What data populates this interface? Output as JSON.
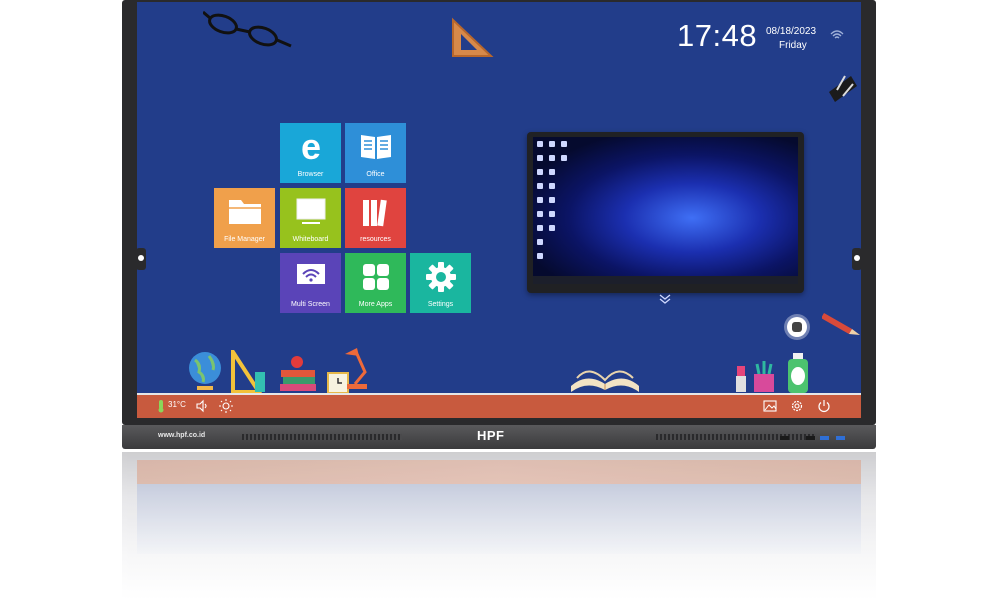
{
  "clock": {
    "time": "17:48",
    "date": "08/18/2023",
    "day": "Friday"
  },
  "apps": [
    {
      "label": "Browser",
      "color": "#19a7d8",
      "icon": "browser-icon"
    },
    {
      "label": "Office",
      "color": "#2e8fd8",
      "icon": "book-icon"
    },
    {
      "label": "File Manager",
      "color": "#f0a04b",
      "icon": "folder-icon"
    },
    {
      "label": "Whiteboard",
      "color": "#97c21d",
      "icon": "whiteboard-icon"
    },
    {
      "label": "resources",
      "color": "#e0443f",
      "icon": "books-icon"
    },
    {
      "label": "Multi Screen",
      "color": "#5a44b8",
      "icon": "wifi-screen-icon"
    },
    {
      "label": "More Apps",
      "color": "#2fb95a",
      "icon": "grid-icon"
    },
    {
      "label": "Settings",
      "color": "#1ab69f",
      "icon": "gear-icon"
    }
  ],
  "shelf": {
    "temperature": "31°C"
  },
  "brand": {
    "name": "HPF",
    "url": "www.hpf.co.id"
  },
  "colors": {
    "screen_bg": "#223d8a",
    "shelf": "#c85a3e",
    "bezel": "#2a2a2c"
  }
}
